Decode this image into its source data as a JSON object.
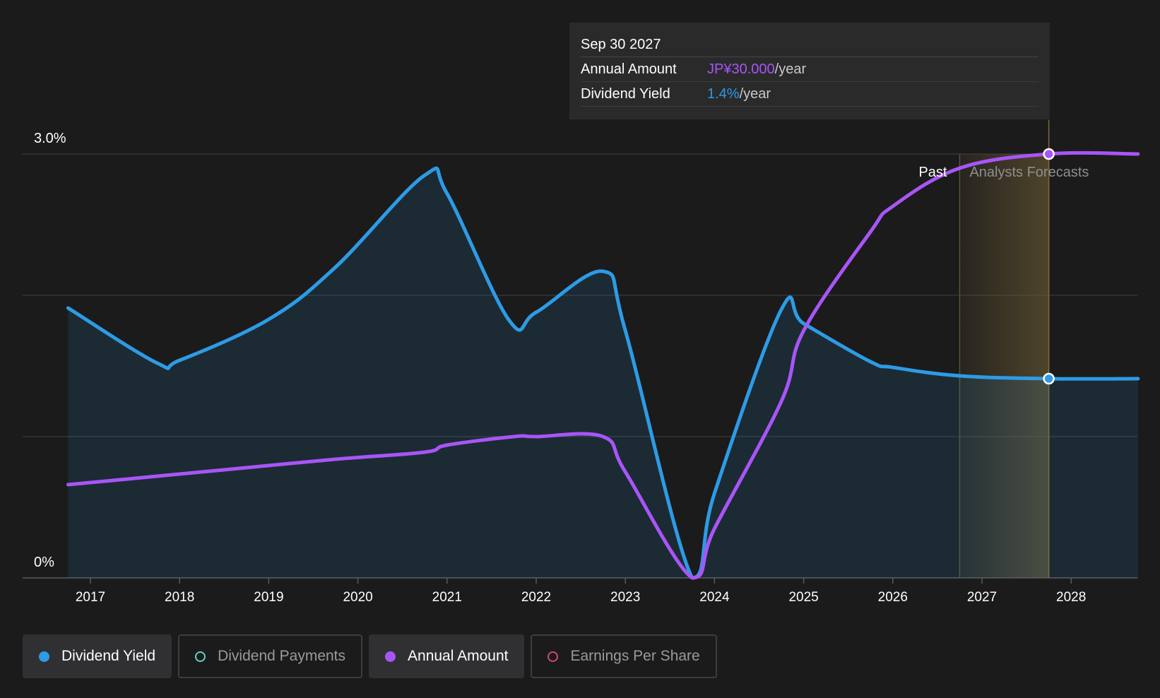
{
  "tooltip": {
    "date": "Sep 30 2027",
    "rows": [
      {
        "label": "Annual Amount",
        "value": "JP¥30.000",
        "unit": "/year",
        "color": "#a855f7"
      },
      {
        "label": "Dividend Yield",
        "value": "1.4%",
        "unit": "/year",
        "color": "#2d9be5"
      }
    ]
  },
  "regions": {
    "past_label": "Past",
    "forecast_label": "Analysts Forecasts"
  },
  "legend": [
    {
      "label": "Dividend Yield",
      "active": true,
      "color": "#2d9be5"
    },
    {
      "label": "Dividend Payments",
      "active": false,
      "color": "#5fd3c0"
    },
    {
      "label": "Annual Amount",
      "active": true,
      "color": "#a855f7"
    },
    {
      "label": "Earnings Per Share",
      "active": false,
      "color": "#d1467c"
    }
  ],
  "colors": {
    "background": "#1b1b1c",
    "dividend_yield": "#2d9be5",
    "annual_amount": "#a855f7",
    "forecast_band": "#6b5a33"
  },
  "chart_data": {
    "type": "line",
    "x_tick_labels": [
      "2017",
      "2018",
      "2019",
      "2020",
      "2021",
      "2022",
      "2023",
      "2024",
      "2025",
      "2026",
      "2027",
      "2028"
    ],
    "y_tick_labels": [
      "3.0%",
      "0%"
    ],
    "ylim": [
      0,
      3.0
    ],
    "xlim": [
      2016.5,
      2028.75
    ],
    "grid": true,
    "gridlines": [
      0,
      1.0,
      2.0,
      3.0
    ],
    "forecast_region": [
      2026.75,
      2027.75
    ],
    "highlight_x": 2027.75,
    "series": [
      {
        "name": "Dividend Yield",
        "fill": true,
        "points": [
          [
            2016.75,
            1.91
          ],
          [
            2017.75,
            1.52
          ],
          [
            2018.0,
            1.54
          ],
          [
            2019.0,
            1.83
          ],
          [
            2019.75,
            2.2
          ],
          [
            2020.75,
            2.85
          ],
          [
            2021.0,
            2.72
          ],
          [
            2021.7,
            1.82
          ],
          [
            2022.0,
            1.88
          ],
          [
            2022.75,
            2.17
          ],
          [
            2023.0,
            1.75
          ],
          [
            2023.75,
            0.0
          ],
          [
            2024.0,
            0.6
          ],
          [
            2024.75,
            1.9
          ],
          [
            2025.0,
            1.8
          ],
          [
            2025.75,
            1.53
          ],
          [
            2026.0,
            1.49
          ],
          [
            2026.75,
            1.43
          ],
          [
            2027.75,
            1.41
          ],
          [
            2028.75,
            1.41
          ]
        ]
      },
      {
        "name": "Annual Amount",
        "fill": false,
        "points": [
          [
            2016.75,
            0.66
          ],
          [
            2017.75,
            0.72
          ],
          [
            2018.75,
            0.78
          ],
          [
            2019.75,
            0.84
          ],
          [
            2020.75,
            0.89
          ],
          [
            2021.0,
            0.94
          ],
          [
            2021.75,
            1.0
          ],
          [
            2022.0,
            1.0
          ],
          [
            2022.75,
            1.0
          ],
          [
            2023.0,
            0.75
          ],
          [
            2023.75,
            0.0
          ],
          [
            2024.0,
            0.35
          ],
          [
            2024.75,
            1.25
          ],
          [
            2025.0,
            1.75
          ],
          [
            2025.75,
            2.45
          ],
          [
            2026.0,
            2.63
          ],
          [
            2026.75,
            2.9
          ],
          [
            2027.75,
            3.0
          ],
          [
            2028.75,
            3.0
          ]
        ]
      }
    ]
  }
}
